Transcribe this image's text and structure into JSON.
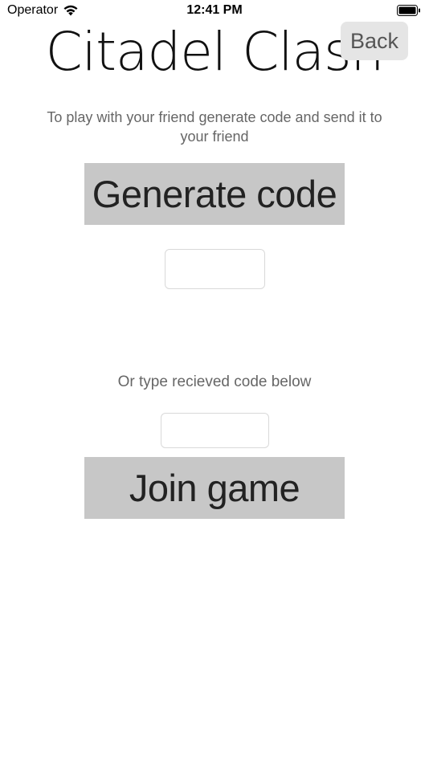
{
  "status_bar": {
    "carrier": "Operator",
    "time": "12:41 PM"
  },
  "header": {
    "title": "Citadel Clash",
    "back_label": "Back"
  },
  "main": {
    "instructions": "To play with your friend generate code and send it to your friend",
    "generate_label": "Generate code",
    "generated_code": "",
    "or_label": "Or type recieved code below",
    "code_input_value": "",
    "code_input_placeholder": "",
    "join_label": "Join game"
  },
  "icons": {
    "wifi": "wifi-icon",
    "battery": "battery-icon"
  },
  "colors": {
    "button_bg": "#c7c7c7",
    "back_bg": "#e5e5e5",
    "background": "#ffffff"
  }
}
